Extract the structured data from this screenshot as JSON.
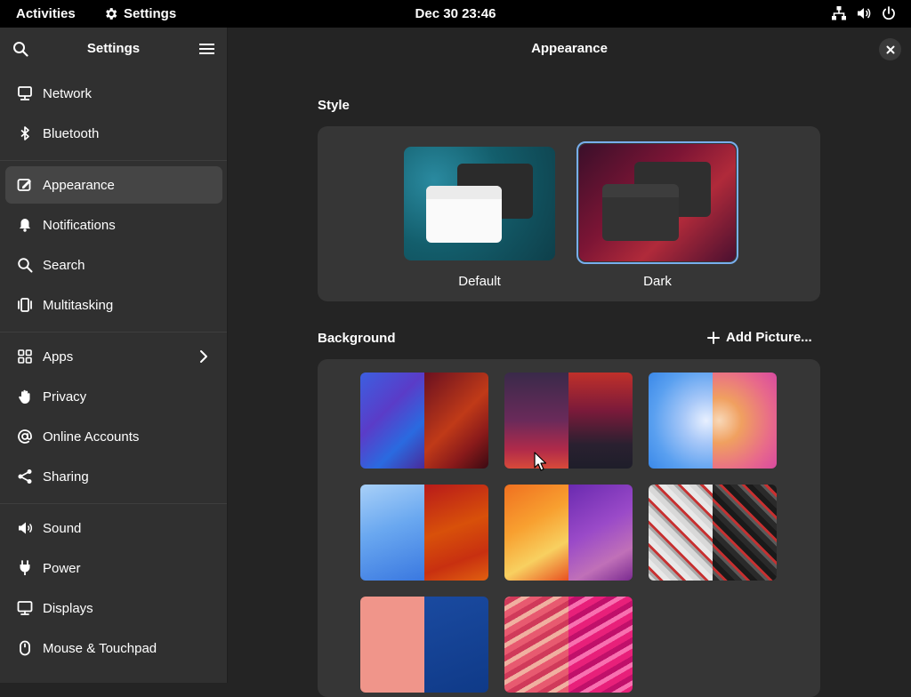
{
  "topbar": {
    "activities": "Activities",
    "app_name": "Settings",
    "clock": "Dec 30  23:46"
  },
  "sidebar": {
    "title": "Settings",
    "items": [
      {
        "label": "Network",
        "icon": "network-icon"
      },
      {
        "label": "Bluetooth",
        "icon": "bluetooth-icon"
      },
      {
        "label": "Appearance",
        "icon": "appearance-icon",
        "active": true
      },
      {
        "label": "Notifications",
        "icon": "bell-icon"
      },
      {
        "label": "Search",
        "icon": "search-icon"
      },
      {
        "label": "Multitasking",
        "icon": "multitasking-icon"
      },
      {
        "label": "Apps",
        "icon": "apps-grid-icon",
        "has_chevron": true
      },
      {
        "label": "Privacy",
        "icon": "hand-icon"
      },
      {
        "label": "Online Accounts",
        "icon": "at-sign-icon"
      },
      {
        "label": "Sharing",
        "icon": "share-icon"
      },
      {
        "label": "Sound",
        "icon": "speaker-icon"
      },
      {
        "label": "Power",
        "icon": "power-plug-icon"
      },
      {
        "label": "Displays",
        "icon": "monitor-icon"
      },
      {
        "label": "Mouse & Touchpad",
        "icon": "mouse-icon"
      }
    ]
  },
  "main": {
    "title": "Appearance",
    "style": {
      "label": "Style",
      "options": [
        {
          "label": "Default",
          "selected": false
        },
        {
          "label": "Dark",
          "selected": true
        }
      ]
    },
    "background": {
      "label": "Background",
      "add_picture": "Add Picture..."
    }
  },
  "colors": {
    "accent": "#78aeed",
    "sidebar_bg": "#303030",
    "content_bg": "#242424",
    "card_bg": "#363636",
    "selected_row": "#454545"
  }
}
